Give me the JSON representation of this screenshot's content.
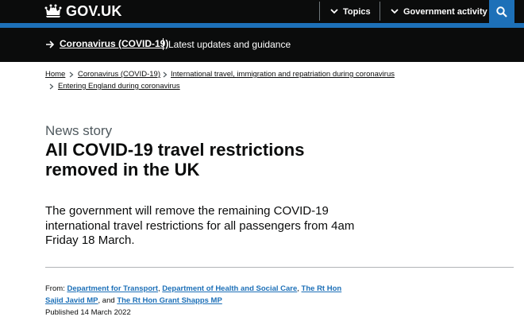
{
  "header": {
    "logo_text": "GOV.UK",
    "topics_label": "Topics",
    "activity_label": "Government activity",
    "colors": {
      "bar": "#0b0c0c",
      "accent": "#1d70b8"
    }
  },
  "banner": {
    "link_text": "Coronavirus (COVID-19)",
    "tagline": "Latest updates and guidance"
  },
  "breadcrumbs": [
    "Home",
    "Coronavirus (COVID-19)",
    "International travel, immigration and repatriation during coronavirus",
    "Entering England during coronavirus"
  ],
  "article": {
    "caption": "News story",
    "title": "All COVID-19 travel restrictions removed in the UK",
    "lead": "The government will remove the remaining COVID-19 international travel restrictions for all passengers from 4am Friday 18 March."
  },
  "meta": {
    "from_label": "From:",
    "orgs": [
      "Department for Transport",
      "Department of Health and Social Care",
      "The Rt Hon Sajid Javid MP",
      "The Rt Hon Grant Shapps MP"
    ],
    "comma": ",",
    "and_text": ", and",
    "published": "Published 14 March 2022"
  }
}
